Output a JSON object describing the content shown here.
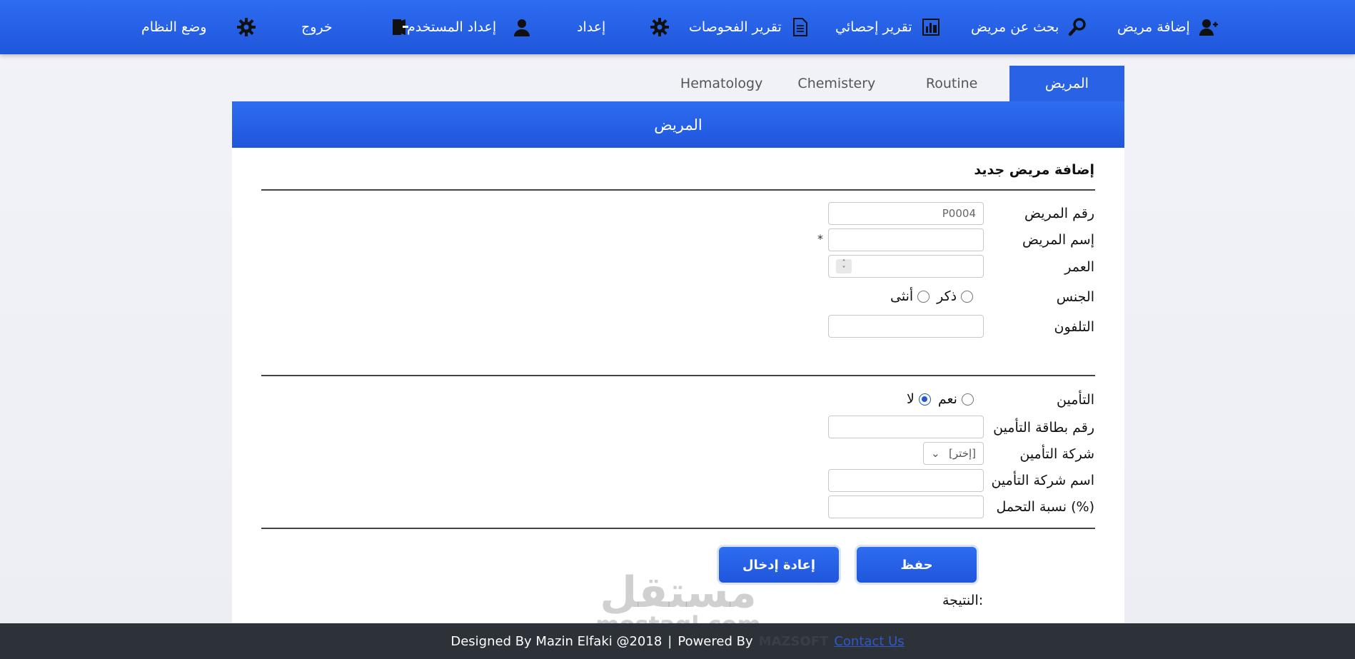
{
  "nav": {
    "add_patient": "إضافة مريض",
    "search_patient": "بحث عن مريض",
    "stats_report": "تقرير إحصائي",
    "tests_report": "تقرير الفحوصات",
    "setup": "إعداد",
    "user_setup": "إعداد المستخدم",
    "logout": "خروج",
    "system_mode": "وضع النظام"
  },
  "tabs": [
    "المريض",
    "Routine",
    "Chemistery",
    "Hematology"
  ],
  "card": {
    "header": "المريض",
    "section_title": "إضافة مريض جديد"
  },
  "form": {
    "patient_no_label": "رقم المريض",
    "patient_no_value": "P0004",
    "patient_name_label": "إسم المريض",
    "required_mark": "*",
    "age_label": "العمر",
    "gender_label": "الجنس",
    "gender_male": "ذكر",
    "gender_female": "أنثى",
    "phone_label": "التلفون",
    "insurance_label": "التأمين",
    "insurance_yes": "نعم",
    "insurance_no": "لا",
    "card_no_label": "رقم بطاقة التأمين",
    "company_label": "شركة التأمين",
    "company_select": "[إختر]",
    "company_name_label": "اسم شركة التأمين",
    "coverage_label": "نسبة التحمل (%)",
    "save_button": "حفظ",
    "reset_button": "إعادة إدخال",
    "result_label": "النتيجة:"
  },
  "watermark": {
    "arabic": "مستقل",
    "latin": "mostaql.com"
  },
  "footer": {
    "designed_by": "Designed By Mazin Elfaki @2018",
    "separator": "|",
    "powered_by": "Powered By",
    "brand": "MAZSOFT",
    "contact": "Contact Us"
  },
  "colors": {
    "primary": "#1f56dc",
    "footer_bg": "#2d3238"
  }
}
